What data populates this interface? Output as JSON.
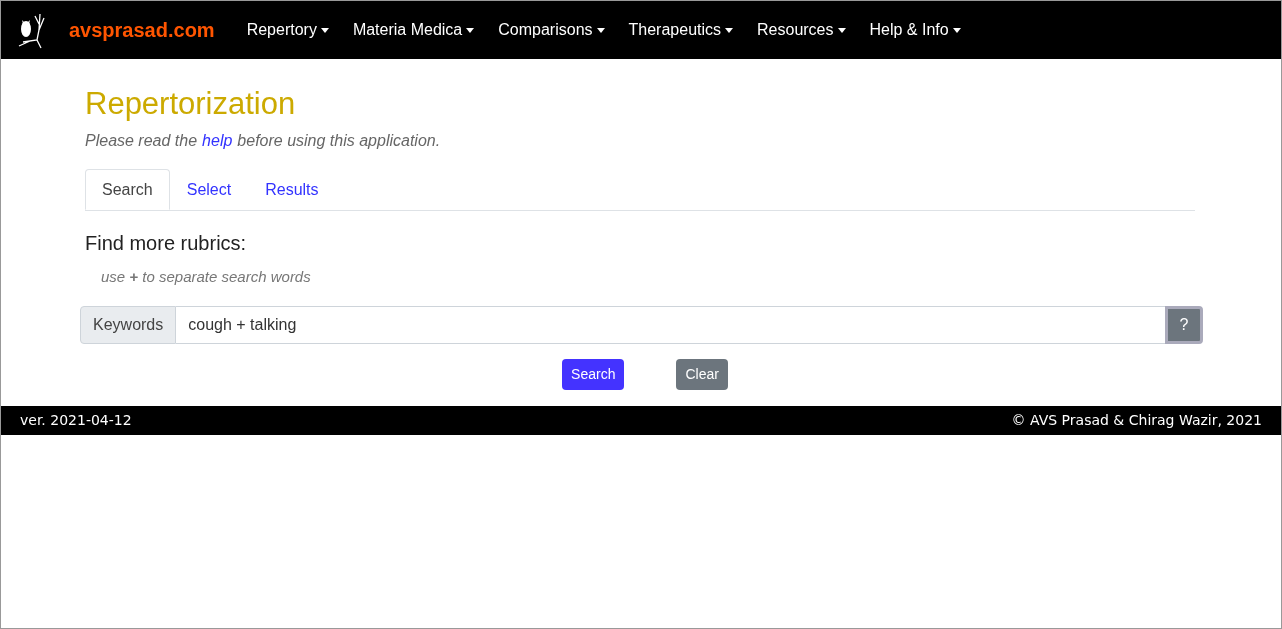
{
  "navbar": {
    "brand": "avsprasad.com",
    "menus": [
      {
        "label": "Repertory"
      },
      {
        "label": "Materia Medica"
      },
      {
        "label": "Comparisons"
      },
      {
        "label": "Therapeutics"
      },
      {
        "label": "Resources"
      },
      {
        "label": "Help & Info"
      }
    ]
  },
  "page": {
    "title": "Repertorization",
    "intro": {
      "before": "Please read the",
      "link": "help",
      "after": "before using this application."
    }
  },
  "tabs": [
    {
      "label": "Search",
      "selected": true
    },
    {
      "label": "Select",
      "selected": false
    },
    {
      "label": "Results",
      "selected": false
    }
  ],
  "search": {
    "heading": "Find more rubrics:",
    "hint": "use **+** to separate search words",
    "addon": "Keywords",
    "value": "cough + talking",
    "help_button": "?",
    "buttons": [
      {
        "label": "Search",
        "kind": "primary"
      },
      {
        "label": "Clear",
        "kind": "secondary"
      }
    ]
  },
  "footer": {
    "version": "ver. 2021-04-12",
    "copyright": "© AVS Prasad & Chirag Wazir, 2021"
  }
}
